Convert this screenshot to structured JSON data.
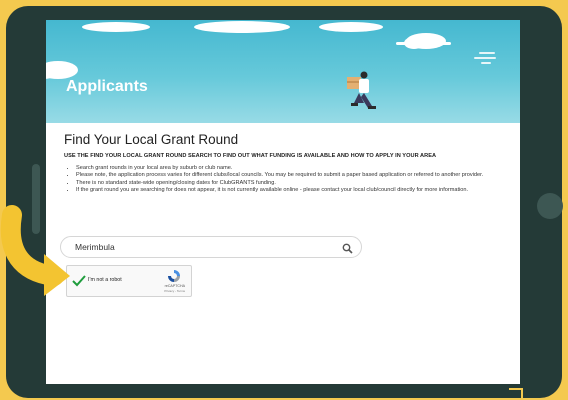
{
  "banner": {
    "title": "Applicants"
  },
  "main": {
    "title": "Find Your Local Grant Round",
    "subheading": "USE THE FIND YOUR LOCAL GRANT ROUND SEARCH TO FIND OUT WHAT FUNDING IS AVAILABLE AND HOW TO APPLY IN YOUR AREA",
    "bullets": [
      "Search grant rounds in your local area by suburb or club name.",
      "Please note, the application process varies for different clubs/local councils. You may be required to submit a paper based application or referred to another provider.",
      "There is no standard state-wide opening/closing dates for ClubGRANTS funding.",
      "If the grant round you are searching for does not appear, it is not currently available online - please contact your local club/council directly for more information."
    ]
  },
  "search": {
    "value": "Merimbula",
    "icon": "search-icon"
  },
  "captcha": {
    "label": "I'm not a robot",
    "brand": "reCAPTCHA",
    "terms": "Privacy - Terms"
  },
  "colors": {
    "background": "#f4c94f",
    "tablet": "#243a37",
    "banner": "#66c9da",
    "pointer": "#f3c431",
    "check": "#1f9d3d"
  }
}
